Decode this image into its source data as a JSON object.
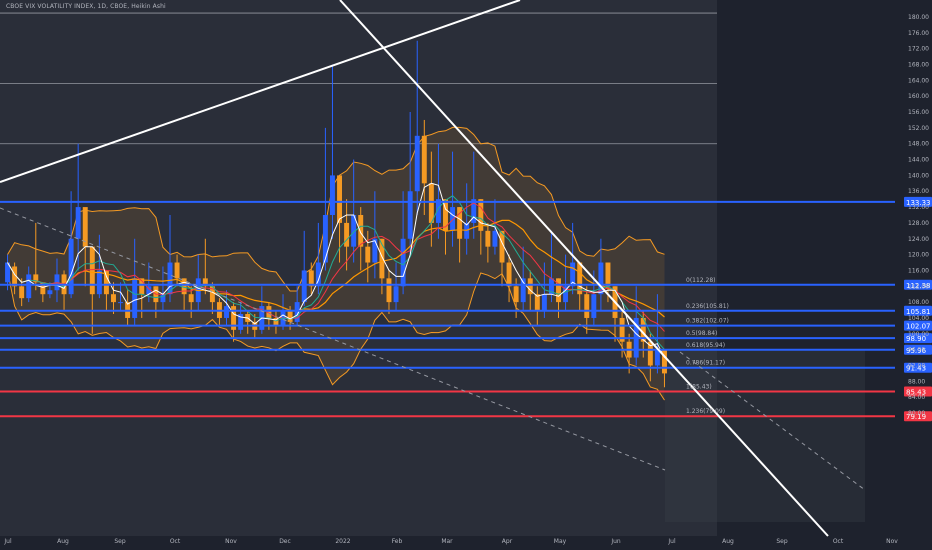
{
  "header": {
    "title": "CBOE VIX VOLATILITY INDEX, 1D, CBOE, Heikin Ashi"
  },
  "colors": {
    "background": "#1e222d",
    "price_area_bg": "#2a2e39",
    "future_bg": "#1e222d",
    "candle_up": "#2962ff",
    "candle_down": "#f59a23",
    "support_line": "#2962ff",
    "red_line": "#f23645",
    "trendline": "#ffffff",
    "grey_line": "#9598a1",
    "axis_text": "#b2b5be",
    "band": "#f59a23",
    "ma_green": "#22ab94",
    "ma_red": "#f23645",
    "ma_white": "#ffffff",
    "ma_orange": "#ff9800"
  },
  "chart_data": {
    "type": "candlestick",
    "title": "CBOE VIX VOLATILITY INDEX, 1D, CBOE, Heikin Ashi",
    "x_tick_labels": [
      "Jul",
      "Aug",
      "Sep",
      "Oct",
      "Nov",
      "Dec",
      "2022",
      "Feb",
      "Mar",
      "Apr",
      "May",
      "Jun",
      "Jul",
      "Aug",
      "Sep",
      "Oct",
      "Nov"
    ],
    "y_tick_labels": [
      "180.00",
      "176.00",
      "172.00",
      "168.00",
      "164.00",
      "160.00",
      "156.00",
      "152.00",
      "148.00",
      "144.00",
      "140.00",
      "136.00",
      "132.00",
      "128.00",
      "124.00",
      "120.00",
      "116.00",
      "112.00",
      "108.00",
      "104.00",
      "100.00",
      "96.00",
      "92.00",
      "88.00",
      "84.00",
      "80.00"
    ],
    "ylim": [
      76,
      183
    ],
    "y_scale": "linear",
    "grid": false,
    "price_levels": [
      {
        "label": "133.33",
        "value": 133.33,
        "color": "#2962ff"
      },
      {
        "label": "112.38",
        "value": 112.38,
        "color": "#2962ff"
      },
      {
        "label": "105.81",
        "value": 105.81,
        "color": "#2962ff"
      },
      {
        "label": "102.07",
        "value": 102.07,
        "color": "#2962ff"
      },
      {
        "label": "98.90",
        "value": 98.9,
        "color": "#2962ff"
      },
      {
        "label": "95.96",
        "value": 95.96,
        "color": "#2962ff"
      },
      {
        "label": "91.43",
        "value": 91.43,
        "color": "#2962ff"
      },
      {
        "label": "85.43",
        "value": 85.43,
        "color": "#f23645"
      },
      {
        "label": "79.19",
        "value": 79.19,
        "color": "#f23645"
      }
    ],
    "grey_levels": [
      181,
      163.2,
      148
    ],
    "fib_labels": [
      {
        "label": "0(112.28)",
        "value": 112.38
      },
      {
        "label": "0.236(105.81)",
        "value": 105.81
      },
      {
        "label": "0.382(102.07)",
        "value": 102.07
      },
      {
        "label": "0.5(98.84)",
        "value": 98.9
      },
      {
        "label": "0.618(95.94)",
        "value": 95.96
      },
      {
        "label": "0.786(91.17)",
        "value": 91.43
      },
      {
        "label": "1(85.43)",
        "value": 85.43
      },
      {
        "label": "1.236(79.09)",
        "value": 79.19
      }
    ],
    "candles": [
      {
        "o": 113.0,
        "c": 118.0,
        "h": 120.0,
        "l": 111.0
      },
      {
        "o": 117.0,
        "c": 112.0,
        "h": 118.0,
        "l": 110.0
      },
      {
        "o": 112.0,
        "c": 109.0,
        "h": 114.0,
        "l": 107.0
      },
      {
        "o": 109.0,
        "c": 115.0,
        "h": 117.0,
        "l": 108.0
      },
      {
        "o": 115.0,
        "c": 113.0,
        "h": 128.0,
        "l": 111.0
      },
      {
        "o": 113.0,
        "c": 110.0,
        "h": 113.0,
        "l": 108.0
      },
      {
        "o": 110.0,
        "c": 111.0,
        "h": 113.0,
        "l": 109.0
      },
      {
        "o": 111.0,
        "c": 115.0,
        "h": 119.0,
        "l": 108.0
      },
      {
        "o": 115.0,
        "c": 110.0,
        "h": 116.0,
        "l": 106.0
      },
      {
        "o": 110.0,
        "c": 124.0,
        "h": 136.0,
        "l": 109.0
      },
      {
        "o": 124.0,
        "c": 132.0,
        "h": 148.0,
        "l": 116.0
      },
      {
        "o": 132.0,
        "c": 122.0,
        "h": 130.0,
        "l": 112.0
      },
      {
        "o": 122.0,
        "c": 110.0,
        "h": 120.0,
        "l": 100.0
      },
      {
        "o": 110.0,
        "c": 116.0,
        "h": 125.0,
        "l": 109.0
      },
      {
        "o": 116.0,
        "c": 110.0,
        "h": 116.0,
        "l": 106.0
      },
      {
        "o": 110.0,
        "c": 108.0,
        "h": 113.0,
        "l": 105.0
      },
      {
        "o": 108.0,
        "c": 108.0,
        "h": 113.0,
        "l": 106.0
      },
      {
        "o": 108.0,
        "c": 104.0,
        "h": 111.0,
        "l": 102.0
      },
      {
        "o": 104.0,
        "c": 114.0,
        "h": 124.0,
        "l": 102.0
      },
      {
        "o": 114.0,
        "c": 110.0,
        "h": 113.0,
        "l": 104.0
      },
      {
        "o": 110.0,
        "c": 112.0,
        "h": 118.0,
        "l": 108.0
      },
      {
        "o": 112.0,
        "c": 108.0,
        "h": 112.0,
        "l": 104.0
      },
      {
        "o": 108.0,
        "c": 110.0,
        "h": 117.0,
        "l": 106.0
      },
      {
        "o": 110.0,
        "c": 118.0,
        "h": 130.0,
        "l": 108.0
      },
      {
        "o": 118.0,
        "c": 114.0,
        "h": 120.0,
        "l": 112.0
      },
      {
        "o": 114.0,
        "c": 110.0,
        "h": 114.0,
        "l": 106.0
      },
      {
        "o": 110.0,
        "c": 108.0,
        "h": 112.0,
        "l": 104.0
      },
      {
        "o": 108.0,
        "c": 114.0,
        "h": 120.0,
        "l": 106.0
      },
      {
        "o": 114.0,
        "c": 112.0,
        "h": 124.0,
        "l": 110.0
      },
      {
        "o": 112.0,
        "c": 108.0,
        "h": 113.0,
        "l": 105.0
      },
      {
        "o": 108.0,
        "c": 104.0,
        "h": 109.0,
        "l": 102.0
      },
      {
        "o": 104.0,
        "c": 107.0,
        "h": 111.0,
        "l": 102.0
      },
      {
        "o": 107.0,
        "c": 101.0,
        "h": 108.0,
        "l": 98.0
      },
      {
        "o": 101.0,
        "c": 105.0,
        "h": 108.0,
        "l": 100.0
      },
      {
        "o": 105.0,
        "c": 103.0,
        "h": 106.0,
        "l": 100.0
      },
      {
        "o": 103.0,
        "c": 101.0,
        "h": 105.0,
        "l": 99.0
      },
      {
        "o": 101.0,
        "c": 107.0,
        "h": 112.0,
        "l": 100.0
      },
      {
        "o": 107.0,
        "c": 104.0,
        "h": 108.0,
        "l": 101.0
      },
      {
        "o": 104.0,
        "c": 102.0,
        "h": 106.0,
        "l": 100.0
      },
      {
        "o": 102.0,
        "c": 106.0,
        "h": 110.0,
        "l": 101.0
      },
      {
        "o": 106.0,
        "c": 103.0,
        "h": 107.0,
        "l": 101.0
      },
      {
        "o": 103.0,
        "c": 108.0,
        "h": 112.0,
        "l": 102.0
      },
      {
        "o": 108.0,
        "c": 116.0,
        "h": 126.0,
        "l": 107.0
      },
      {
        "o": 116.0,
        "c": 112.0,
        "h": 118.0,
        "l": 110.0
      },
      {
        "o": 112.0,
        "c": 118.0,
        "h": 128.0,
        "l": 110.0
      },
      {
        "o": 118.0,
        "c": 130.0,
        "h": 152.0,
        "l": 116.0
      },
      {
        "o": 130.0,
        "c": 140.0,
        "h": 168.0,
        "l": 124.0
      },
      {
        "o": 140.0,
        "c": 128.0,
        "h": 140.0,
        "l": 118.0
      },
      {
        "o": 128.0,
        "c": 122.0,
        "h": 134.0,
        "l": 116.0
      },
      {
        "o": 122.0,
        "c": 130.0,
        "h": 144.0,
        "l": 118.0
      },
      {
        "o": 130.0,
        "c": 122.0,
        "h": 132.0,
        "l": 116.0
      },
      {
        "o": 122.0,
        "c": 118.0,
        "h": 126.0,
        "l": 113.0
      },
      {
        "o": 118.0,
        "c": 124.0,
        "h": 136.0,
        "l": 114.0
      },
      {
        "o": 124.0,
        "c": 114.0,
        "h": 124.0,
        "l": 110.0
      },
      {
        "o": 114.0,
        "c": 108.0,
        "h": 116.0,
        "l": 105.0
      },
      {
        "o": 108.0,
        "c": 112.0,
        "h": 118.0,
        "l": 106.0
      },
      {
        "o": 112.0,
        "c": 124.0,
        "h": 136.0,
        "l": 110.0
      },
      {
        "o": 124.0,
        "c": 136.0,
        "h": 156.0,
        "l": 120.0
      },
      {
        "o": 136.0,
        "c": 150.0,
        "h": 174.0,
        "l": 130.0
      },
      {
        "o": 150.0,
        "c": 138.0,
        "h": 154.0,
        "l": 130.0
      },
      {
        "o": 138.0,
        "c": 128.0,
        "h": 146.0,
        "l": 122.0
      },
      {
        "o": 128.0,
        "c": 134.0,
        "h": 148.0,
        "l": 124.0
      },
      {
        "o": 134.0,
        "c": 126.0,
        "h": 134.0,
        "l": 120.0
      },
      {
        "o": 126.0,
        "c": 132.0,
        "h": 146.0,
        "l": 122.0
      },
      {
        "o": 132.0,
        "c": 124.0,
        "h": 132.0,
        "l": 118.0
      },
      {
        "o": 124.0,
        "c": 128.0,
        "h": 138.0,
        "l": 120.0
      },
      {
        "o": 128.0,
        "c": 134.0,
        "h": 146.0,
        "l": 124.0
      },
      {
        "o": 134.0,
        "c": 126.0,
        "h": 134.0,
        "l": 120.0
      },
      {
        "o": 126.0,
        "c": 122.0,
        "h": 128.0,
        "l": 118.0
      },
      {
        "o": 122.0,
        "c": 126.0,
        "h": 134.0,
        "l": 120.0
      },
      {
        "o": 126.0,
        "c": 118.0,
        "h": 126.0,
        "l": 112.0
      },
      {
        "o": 118.0,
        "c": 112.0,
        "h": 120.0,
        "l": 108.0
      },
      {
        "o": 112.0,
        "c": 108.0,
        "h": 114.0,
        "l": 104.0
      },
      {
        "o": 108.0,
        "c": 114.0,
        "h": 122.0,
        "l": 106.0
      },
      {
        "o": 114.0,
        "c": 110.0,
        "h": 116.0,
        "l": 106.0
      },
      {
        "o": 110.0,
        "c": 106.0,
        "h": 112.0,
        "l": 102.0
      },
      {
        "o": 106.0,
        "c": 110.0,
        "h": 118.0,
        "l": 104.0
      },
      {
        "o": 110.0,
        "c": 114.0,
        "h": 126.0,
        "l": 108.0
      },
      {
        "o": 114.0,
        "c": 108.0,
        "h": 114.0,
        "l": 104.0
      },
      {
        "o": 108.0,
        "c": 112.0,
        "h": 120.0,
        "l": 106.0
      },
      {
        "o": 112.0,
        "c": 118.0,
        "h": 128.0,
        "l": 110.0
      },
      {
        "o": 118.0,
        "c": 110.0,
        "h": 118.0,
        "l": 106.0
      },
      {
        "o": 110.0,
        "c": 104.0,
        "h": 112.0,
        "l": 100.0
      },
      {
        "o": 104.0,
        "c": 110.0,
        "h": 116.0,
        "l": 102.0
      },
      {
        "o": 110.0,
        "c": 118.0,
        "h": 124.0,
        "l": 106.0
      },
      {
        "o": 118.0,
        "c": 112.0,
        "h": 118.0,
        "l": 108.0
      },
      {
        "o": 112.0,
        "c": 104.0,
        "h": 112.0,
        "l": 98.0
      },
      {
        "o": 104.0,
        "c": 98.0,
        "h": 106.0,
        "l": 94.0
      },
      {
        "o": 98.0,
        "c": 94.0,
        "h": 100.0,
        "l": 90.0
      },
      {
        "o": 94.0,
        "c": 104.0,
        "h": 112.0,
        "l": 92.0
      },
      {
        "o": 104.0,
        "c": 98.0,
        "h": 106.0,
        "l": 94.0
      },
      {
        "o": 98.0,
        "c": 92.0,
        "h": 100.0,
        "l": 88.0
      },
      {
        "o": 92.0,
        "c": 96.0,
        "h": 110.0,
        "l": 90.0
      },
      {
        "o": 96.0,
        "c": 90.0,
        "h": 96.0,
        "l": 86.5
      }
    ]
  }
}
